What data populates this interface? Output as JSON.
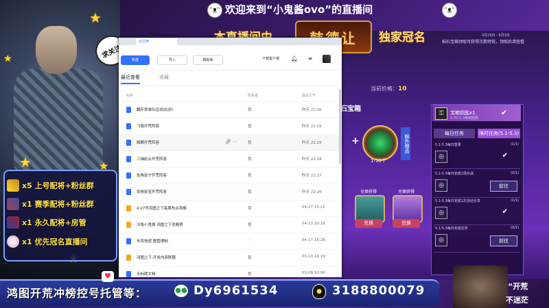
{
  "overlay": {
    "welcome_text": "欢迎来到“小鬼酱ovo”的直播间",
    "banner_left": "本直播间由",
    "banner_name": "韩德让",
    "banner_right": "独家冠名",
    "follow_bubble": "求关注",
    "perks": [
      {
        "text": "x5 上号配将+粉丝群"
      },
      {
        "text": "x1 赛季配将+粉丝群"
      },
      {
        "text": "x1 永久配将+房管"
      },
      {
        "text": "x1 优先冠名直播间"
      }
    ],
    "bottom_text": "鸿图开荒冲榜控号托管等：",
    "wechat_id": "Dy6961534",
    "qq_id": "3188800079",
    "slogan_1": "“开荒",
    "slogan_2": "不迷茫"
  },
  "browser": {
    "tab_label": "云文档",
    "toolbar": {
      "new_label": "新建",
      "import_label": "导入",
      "template_label": "模板库",
      "download_label": "下载客户端"
    },
    "tabs": {
      "recent": "最近查看",
      "favorites": "收藏"
    },
    "columns": {
      "name": "名称",
      "owner": "所有者",
      "time": "最近打开"
    },
    "rows": [
      {
        "name": "翻斥表单队伍测试(好)",
        "owner": "我",
        "time": "昨天 21:30",
        "icon": "doc",
        "color": "#3370ff"
      },
      {
        "name": "飞扇开荒阵容",
        "owner": "我",
        "time": "昨天 22:29",
        "icon": "doc",
        "color": "#3370ff"
      },
      {
        "name": "姬颗开荒阵容",
        "owner": "我",
        "time": "昨天 22:29",
        "icon": "doc",
        "color": "#3370ff"
      },
      {
        "name": "三袖赵云开荒阵容",
        "owner": "我",
        "time": "昨天 22:28",
        "icon": "doc",
        "color": "#3370ff"
      },
      {
        "name": "张角张宁开荒阵容",
        "owner": "我",
        "time": "昨天 22:27",
        "icon": "doc",
        "color": "#3370ff"
      },
      {
        "name": "张角张宝开荒阵容",
        "owner": "我",
        "time": "昨天 22:26",
        "icon": "doc",
        "color": "#3370ff"
      },
      {
        "name": "4.27号鸿图之下每周热点攻略",
        "owner": "我",
        "time": "04-27 15:21",
        "icon": "folder",
        "color": "#f5a623"
      },
      {
        "name": "冷兔小鬼酱 鸿图之下攻略表",
        "owner": "我",
        "time": "04-23 20:18",
        "icon": "folder",
        "color": "#f5a623"
      },
      {
        "name": "东风快递 盟管理制",
        "owner": "-",
        "time": "04-17 15:28",
        "icon": "doc",
        "color": "#3370ff"
      },
      {
        "name": "鸿图之下-开发内容联盟",
        "owner": "我",
        "time": "03-10 14:19",
        "icon": "folder",
        "color": "#f5a623"
      },
      {
        "name": "无标题文档",
        "owner": "我",
        "time": "03-08 10:00",
        "icon": "doc",
        "color": "#3370ff"
      }
    ]
  },
  "game": {
    "date_range": "4月29日 - 5月3日",
    "note": "稻石宝箱领取可获得次数特效，领取后请查看",
    "price_label": "当前价格：",
    "price_value": "10",
    "box_title": "钻石宝箱",
    "gem_label": "1-10个",
    "exclusive_label": "额外赠品",
    "chest_tags": [
      "兑换获得",
      "兑换获得"
    ],
    "exchange_label": "兑换",
    "reward_name": "宝箱钥匙x1",
    "reward_sub": "4.30-5.3使用期限",
    "tabs": {
      "daily": "每日任务",
      "limited": "限时任务(5.1-5.3)"
    },
    "tasks": [
      {
        "title": "5.1-5.3每日登录",
        "count": "(1/1)",
        "done": true
      },
      {
        "title": "5.1-5.3每日完成1场对战",
        "count": "(0/1)",
        "done": false,
        "action": "前往"
      },
      {
        "title": "5.1-5.3每日完成1次活动分享",
        "count": "(1/1)",
        "done": true
      },
      {
        "title": "5.1-5.3每日完成任务",
        "count": "(0/1)",
        "done": false,
        "action": "前往"
      }
    ]
  }
}
